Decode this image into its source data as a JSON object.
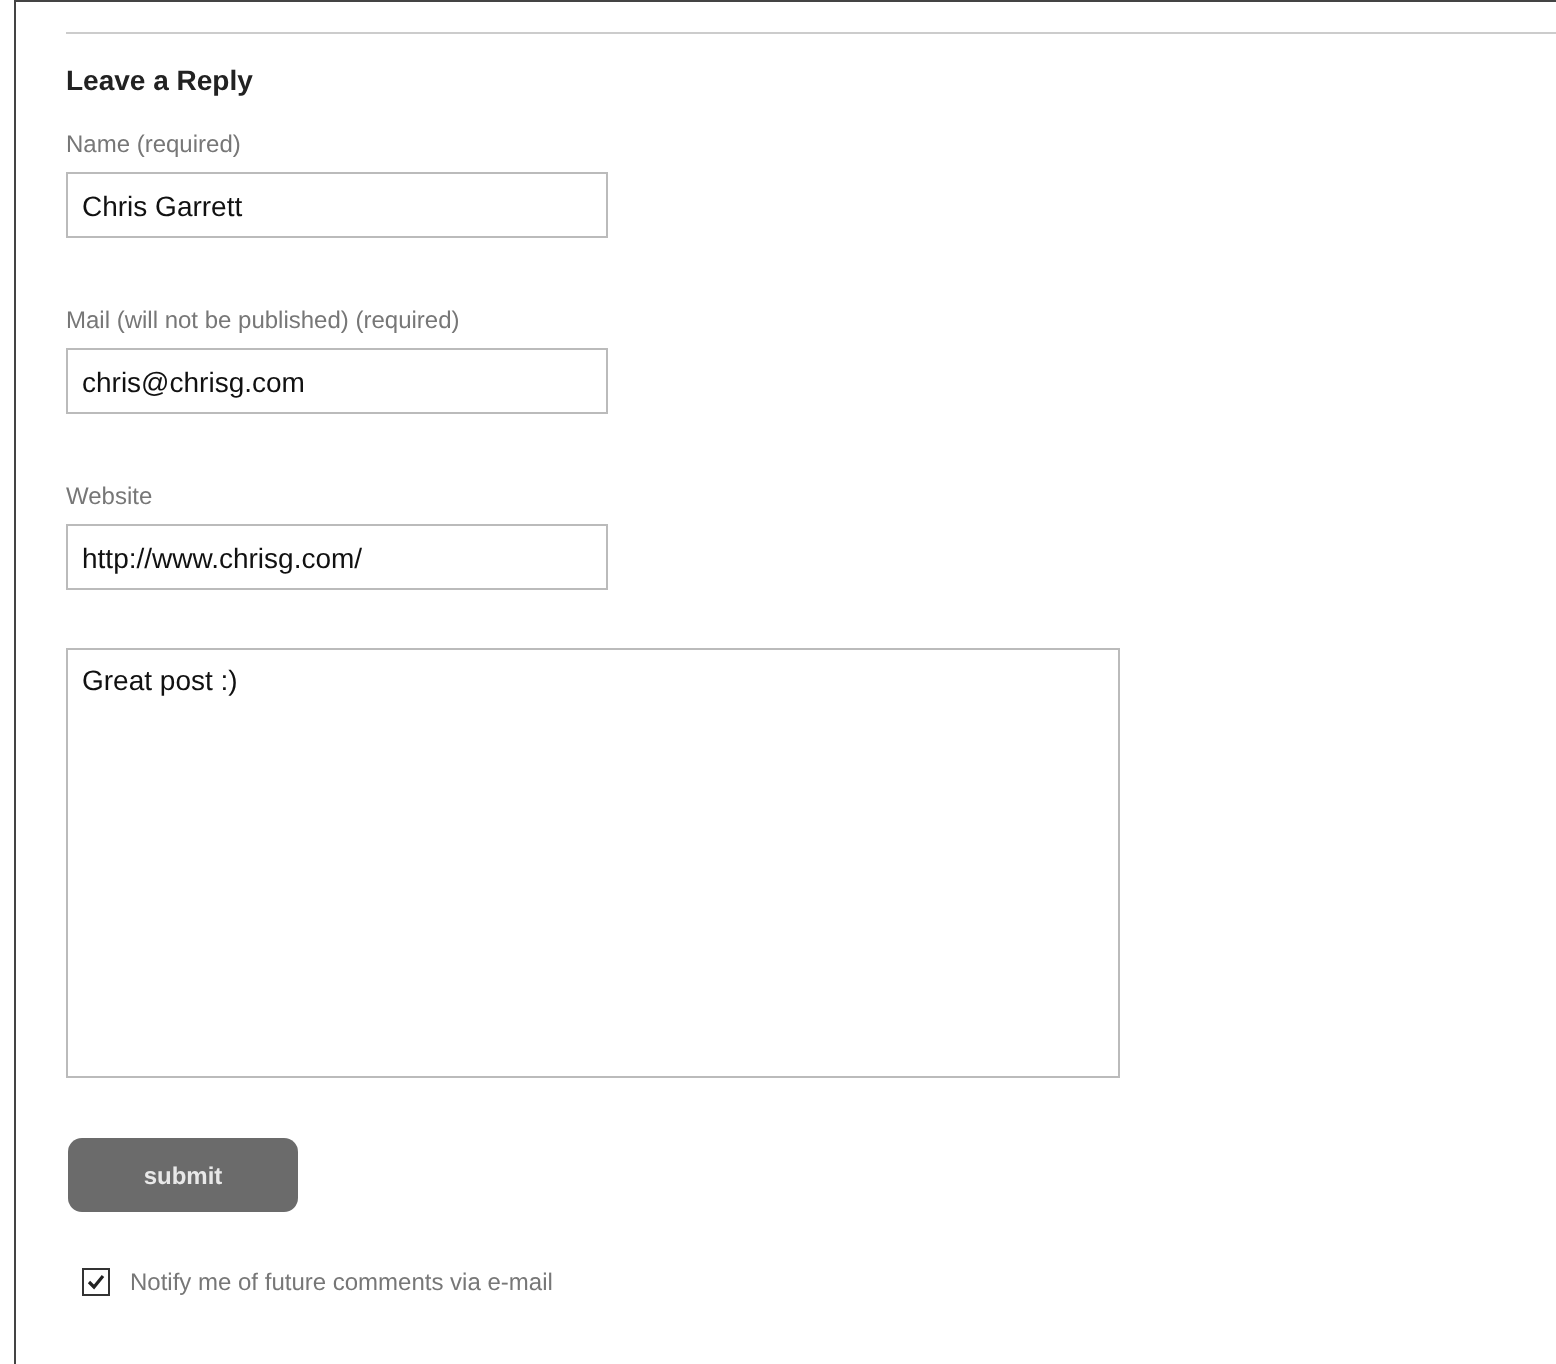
{
  "heading": "Leave a Reply",
  "fields": [
    {
      "label": "Name (required)",
      "value": "Chris Garrett"
    },
    {
      "label": "Mail (will not be published) (required)",
      "value": "chris@chrisg.com"
    },
    {
      "label": "Website",
      "value": "http://www.chrisg.com/"
    }
  ],
  "comment": {
    "value": "Great post :)"
  },
  "submit": "submit",
  "notify": {
    "label": "Notify me of future comments via e-mail",
    "checked": true
  }
}
